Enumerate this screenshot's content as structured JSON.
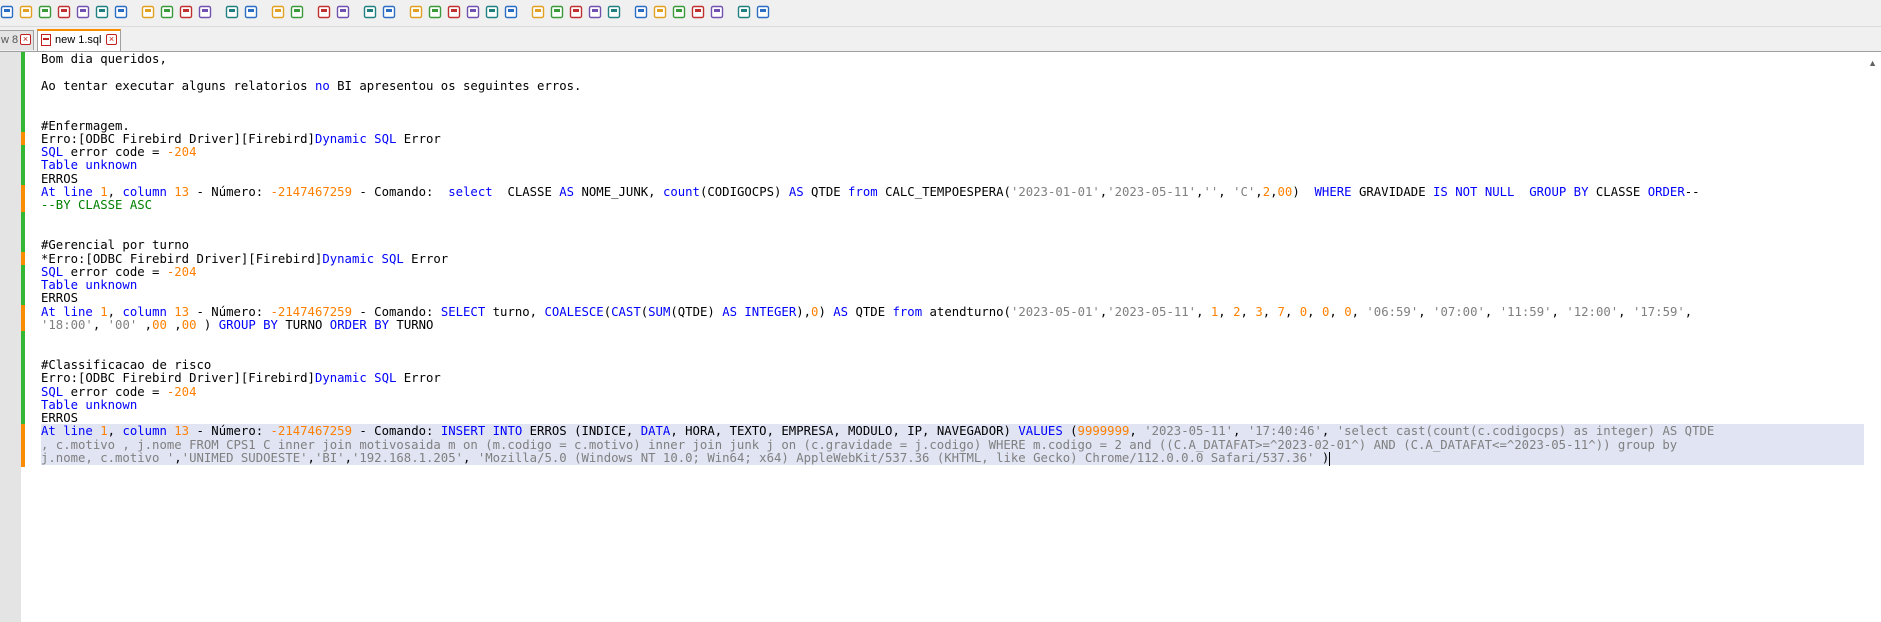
{
  "toolbar": {
    "icons": [
      "new-file",
      "open-file",
      "save",
      "save-all",
      "close",
      "close-all",
      "print",
      "cut",
      "copy",
      "paste",
      "undo",
      "redo",
      "find",
      "replace",
      "zoom-in",
      "zoom-out",
      "sync-vertical",
      "sync-horizontal",
      "word-wrap",
      "show-all-chars",
      "indent-guide",
      "doc-map",
      "function-list",
      "folder-workspace",
      "monitoring",
      "record-macro",
      "stop-macro",
      "play-macro",
      "run-macro-multiple",
      "save-macro",
      "spell-check",
      "columns",
      "align",
      "move-up",
      "move-down",
      "sort",
      "panel"
    ]
  },
  "tabs": [
    {
      "label": "w 8",
      "active": false
    },
    {
      "label": "new 1.sql",
      "active": true
    }
  ],
  "editor": {
    "lines": [
      {
        "state": "saved",
        "tokens": [
          [
            "t",
            "Bom dia queridos,"
          ]
        ]
      },
      {
        "state": "saved",
        "tokens": []
      },
      {
        "state": "saved",
        "tokens": [
          [
            "t",
            "Ao tentar executar alguns relatorios "
          ],
          [
            "kw",
            "no"
          ],
          [
            "t",
            " BI apresentou os seguintes erros."
          ]
        ]
      },
      {
        "state": "saved",
        "tokens": []
      },
      {
        "state": "saved",
        "tokens": []
      },
      {
        "state": "saved",
        "tokens": [
          [
            "t",
            "#Enfermagem."
          ]
        ]
      },
      {
        "state": "mod",
        "tokens": [
          [
            "t",
            "Erro:[ODBC Firebird Driver][Firebird]"
          ],
          [
            "kw",
            "Dynamic SQL"
          ],
          [
            "t",
            " Error"
          ]
        ]
      },
      {
        "state": "saved",
        "tokens": [
          [
            "kw",
            "SQL"
          ],
          [
            "t",
            " error code = "
          ],
          [
            "num",
            "-204"
          ]
        ]
      },
      {
        "state": "saved",
        "tokens": [
          [
            "kw",
            "Table unknown"
          ]
        ]
      },
      {
        "state": "saved",
        "tokens": [
          [
            "t",
            "ERROS"
          ]
        ]
      },
      {
        "state": "mod",
        "tokens": [
          [
            "kw",
            "At line "
          ],
          [
            "num",
            "1"
          ],
          [
            "t",
            ", "
          ],
          [
            "kw",
            "column"
          ],
          [
            "t",
            " "
          ],
          [
            "num",
            "13"
          ],
          [
            "t",
            " - Número: "
          ],
          [
            "num",
            "-2147467259"
          ],
          [
            "t",
            " - Comando:  "
          ],
          [
            "kw",
            "select"
          ],
          [
            "t",
            "  CLASSE "
          ],
          [
            "kw",
            "AS"
          ],
          [
            "t",
            " NOME_JUNK, "
          ],
          [
            "kw",
            "count"
          ],
          [
            "t",
            "(CODIGOCPS) "
          ],
          [
            "kw",
            "AS"
          ],
          [
            "t",
            " QTDE "
          ],
          [
            "kw",
            "from"
          ],
          [
            "t",
            " CALC_TEMPOESPERA("
          ],
          [
            "str",
            "'2023-01-01'"
          ],
          [
            "t",
            ","
          ],
          [
            "str",
            "'2023-05-11'"
          ],
          [
            "t",
            ","
          ],
          [
            "str",
            "''"
          ],
          [
            "t",
            ", "
          ],
          [
            "str",
            "'C'"
          ],
          [
            "t",
            ","
          ],
          [
            "num",
            "2"
          ],
          [
            "t",
            ","
          ],
          [
            "num",
            "00"
          ],
          [
            "t",
            ")  "
          ],
          [
            "kw",
            "WHERE"
          ],
          [
            "t",
            " GRAVIDADE "
          ],
          [
            "kw",
            "IS NOT NULL"
          ],
          [
            "t",
            "  "
          ],
          [
            "kw",
            "GROUP BY"
          ],
          [
            "t",
            " CLASSE "
          ],
          [
            "kw",
            "ORDER"
          ],
          [
            "t",
            "--"
          ]
        ]
      },
      {
        "state": "mod",
        "tokens": [
          [
            "cm",
            "--BY CLASSE ASC"
          ]
        ]
      },
      {
        "state": "saved",
        "tokens": []
      },
      {
        "state": "saved",
        "tokens": []
      },
      {
        "state": "saved",
        "tokens": [
          [
            "t",
            "#Gerencial por turno"
          ]
        ]
      },
      {
        "state": "mod",
        "tokens": [
          [
            "t",
            "*Erro:[ODBC Firebird Driver][Firebird]"
          ],
          [
            "kw",
            "Dynamic SQL"
          ],
          [
            "t",
            " Error"
          ]
        ]
      },
      {
        "state": "saved",
        "tokens": [
          [
            "kw",
            "SQL"
          ],
          [
            "t",
            " error code = "
          ],
          [
            "num",
            "-204"
          ]
        ]
      },
      {
        "state": "saved",
        "tokens": [
          [
            "kw",
            "Table unknown"
          ]
        ]
      },
      {
        "state": "saved",
        "tokens": [
          [
            "t",
            "ERROS"
          ]
        ]
      },
      {
        "state": "mod",
        "tokens": [
          [
            "kw",
            "At line "
          ],
          [
            "num",
            "1"
          ],
          [
            "t",
            ", "
          ],
          [
            "kw",
            "column"
          ],
          [
            "t",
            " "
          ],
          [
            "num",
            "13"
          ],
          [
            "t",
            " - Número: "
          ],
          [
            "num",
            "-2147467259"
          ],
          [
            "t",
            " - Comando: "
          ],
          [
            "kw",
            "SELECT"
          ],
          [
            "t",
            " turno, "
          ],
          [
            "kw",
            "COALESCE"
          ],
          [
            "t",
            "("
          ],
          [
            "kw",
            "CAST"
          ],
          [
            "t",
            "("
          ],
          [
            "kw",
            "SUM"
          ],
          [
            "t",
            "(QTDE) "
          ],
          [
            "kw",
            "AS INTEGER"
          ],
          [
            "t",
            "),"
          ],
          [
            "num",
            "0"
          ],
          [
            "t",
            ") "
          ],
          [
            "kw",
            "AS"
          ],
          [
            "t",
            " QTDE "
          ],
          [
            "kw",
            "from"
          ],
          [
            "t",
            " atendturno("
          ],
          [
            "str",
            "'2023-05-01'"
          ],
          [
            "t",
            ","
          ],
          [
            "str",
            "'2023-05-11'"
          ],
          [
            "t",
            ", "
          ],
          [
            "num",
            "1"
          ],
          [
            "t",
            ", "
          ],
          [
            "num",
            "2"
          ],
          [
            "t",
            ", "
          ],
          [
            "num",
            "3"
          ],
          [
            "t",
            ", "
          ],
          [
            "num",
            "7"
          ],
          [
            "t",
            ", "
          ],
          [
            "num",
            "0"
          ],
          [
            "t",
            ", "
          ],
          [
            "num",
            "0"
          ],
          [
            "t",
            ", "
          ],
          [
            "num",
            "0"
          ],
          [
            "t",
            ", "
          ],
          [
            "str",
            "'06:59'"
          ],
          [
            "t",
            ", "
          ],
          [
            "str",
            "'07:00'"
          ],
          [
            "t",
            ", "
          ],
          [
            "str",
            "'11:59'"
          ],
          [
            "t",
            ", "
          ],
          [
            "str",
            "'12:00'"
          ],
          [
            "t",
            ", "
          ],
          [
            "str",
            "'17:59'"
          ],
          [
            "t",
            ","
          ]
        ]
      },
      {
        "state": "mod",
        "tokens": [
          [
            "str",
            "'18:00'"
          ],
          [
            "t",
            ", "
          ],
          [
            "str",
            "'00'"
          ],
          [
            "t",
            " ,"
          ],
          [
            "num",
            "00"
          ],
          [
            "t",
            " ,"
          ],
          [
            "num",
            "00"
          ],
          [
            "t",
            " ) "
          ],
          [
            "kw",
            "GROUP BY"
          ],
          [
            "t",
            " TURNO "
          ],
          [
            "kw",
            "ORDER BY"
          ],
          [
            "t",
            " TURNO"
          ]
        ]
      },
      {
        "state": "saved",
        "tokens": []
      },
      {
        "state": "saved",
        "tokens": []
      },
      {
        "state": "saved",
        "tokens": [
          [
            "t",
            "#Classificacao de risco"
          ]
        ]
      },
      {
        "state": "saved",
        "tokens": [
          [
            "t",
            "Erro:[ODBC Firebird Driver][Firebird]"
          ],
          [
            "kw",
            "Dynamic SQL"
          ],
          [
            "t",
            " Error"
          ]
        ]
      },
      {
        "state": "saved",
        "tokens": [
          [
            "kw",
            "SQL"
          ],
          [
            "t",
            " error code = "
          ],
          [
            "num",
            "-204"
          ]
        ]
      },
      {
        "state": "saved",
        "tokens": [
          [
            "kw",
            "Table unknown"
          ]
        ]
      },
      {
        "state": "saved",
        "tokens": [
          [
            "t",
            "ERROS"
          ]
        ]
      },
      {
        "state": "mod",
        "sel": true,
        "tokens": [
          [
            "kw",
            "At line "
          ],
          [
            "num",
            "1"
          ],
          [
            "t",
            ", "
          ],
          [
            "kw",
            "column"
          ],
          [
            "t",
            " "
          ],
          [
            "num",
            "13"
          ],
          [
            "t",
            " - Número: "
          ],
          [
            "num",
            "-2147467259"
          ],
          [
            "t",
            " - Comando: "
          ],
          [
            "kw",
            "INSERT INTO"
          ],
          [
            "t",
            " ERROS (INDICE, "
          ],
          [
            "kw",
            "DATA"
          ],
          [
            "t",
            ", HORA, TEXTO, EMPRESA, MODULO, IP, NAVEGADOR) "
          ],
          [
            "kw",
            "VALUES"
          ],
          [
            "t",
            " ("
          ],
          [
            "num",
            "9999999"
          ],
          [
            "t",
            ", "
          ],
          [
            "str",
            "'2023-05-11'"
          ],
          [
            "t",
            ", "
          ],
          [
            "str",
            "'17:40:46'"
          ],
          [
            "t",
            ", "
          ],
          [
            "str",
            "'select cast(count(c.codigocps) as integer) AS QTDE"
          ]
        ]
      },
      {
        "state": "mod",
        "sel": true,
        "tokens": [
          [
            "str",
            ", c.motivo , j.nome FROM CPS1 C inner join motivosaida m on (m.codigo = c.motivo) inner join junk j on (c.gravidade = j.codigo) WHERE m.codigo = 2 and ((C.A_DATAFAT>=^2023-02-01^) AND (C.A_DATAFAT<=^2023-05-11^)) group by"
          ]
        ]
      },
      {
        "state": "mod",
        "sel": true,
        "caret": true,
        "tokens": [
          [
            "str",
            "j.nome, c.motivo '"
          ],
          [
            "t",
            ","
          ],
          [
            "str",
            "'UNIMED SUDOESTE'"
          ],
          [
            "t",
            ","
          ],
          [
            "str",
            "'BI'"
          ],
          [
            "t",
            ","
          ],
          [
            "str",
            "'192.168.1.205'"
          ],
          [
            "t",
            ", "
          ],
          [
            "str",
            "'Mozilla/5.0 (Windows NT 10.0; Win64; x64) AppleWebKit/537.36 (KHTML, like Gecko) Chrome/112.0.0.0 Safari/537.36'"
          ],
          [
            "t",
            " )"
          ]
        ]
      }
    ]
  }
}
